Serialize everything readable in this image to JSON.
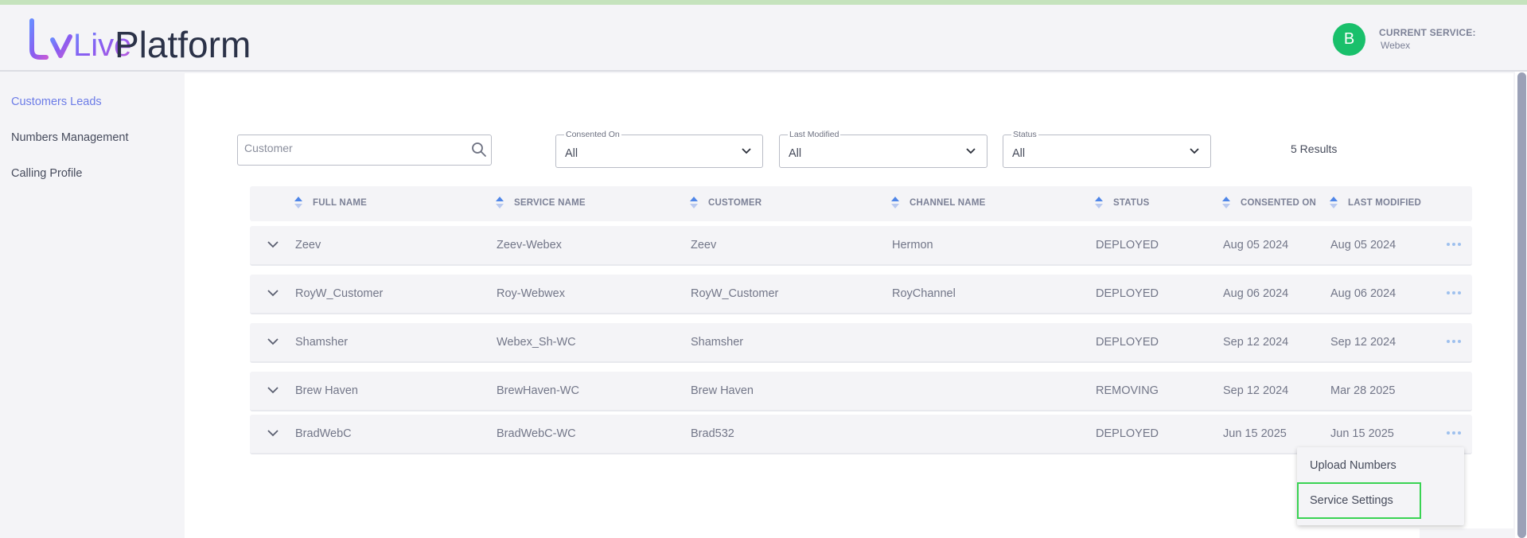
{
  "colors": {
    "accent": "#6c7ce7",
    "avatar": "#19c06b",
    "highlight": "#39d353",
    "sort_icon": "#4f86e8"
  },
  "header": {
    "logo_text_1": "Live",
    "logo_text_2": "Platform",
    "avatar_initial": "B",
    "current_service_label": "CURRENT SERVICE:",
    "current_service_value": "Webex"
  },
  "sidebar": {
    "items": [
      {
        "label": "Customers Leads",
        "active": true
      },
      {
        "label": "Numbers Management",
        "active": false
      },
      {
        "label": "Calling Profile",
        "active": false
      }
    ]
  },
  "filters": {
    "search_placeholder": "Customer",
    "search_icon": "search-icon",
    "consented_on": {
      "label": "Consented On",
      "value": "All"
    },
    "last_modified": {
      "label": "Last Modified",
      "value": "All"
    },
    "status": {
      "label": "Status",
      "value": "All"
    },
    "results": "5 Results"
  },
  "table": {
    "columns": [
      "FULL NAME",
      "SERVICE NAME",
      "CUSTOMER",
      "CHANNEL NAME",
      "STATUS",
      "CONSENTED ON",
      "LAST MODIFIED"
    ],
    "rows": [
      {
        "full_name": "Zeev",
        "service_name": "Zeev-Webex",
        "customer": "Zeev",
        "channel_name": "Hermon",
        "status": "DEPLOYED",
        "consented_on": "Aug 05 2024",
        "last_modified": "Aug 05 2024"
      },
      {
        "full_name": "RoyW_Customer",
        "service_name": "Roy-Webwex",
        "customer": "RoyW_Customer",
        "channel_name": "RoyChannel",
        "status": "DEPLOYED",
        "consented_on": "Aug 06 2024",
        "last_modified": "Aug 06 2024"
      },
      {
        "full_name": "Shamsher",
        "service_name": "Webex_Sh-WC",
        "customer": "Shamsher",
        "channel_name": "",
        "status": "DEPLOYED",
        "consented_on": "Sep 12 2024",
        "last_modified": "Sep 12 2024"
      },
      {
        "full_name": "Brew Haven",
        "service_name": "BrewHaven-WC",
        "customer": "Brew Haven",
        "channel_name": "",
        "status": "REMOVING",
        "consented_on": "Sep 12 2024",
        "last_modified": "Mar 28 2025"
      },
      {
        "full_name": "BradWebC",
        "service_name": "BradWebC-WC",
        "customer": "Brad532",
        "channel_name": "",
        "status": "DEPLOYED",
        "consented_on": "Jun 15 2025",
        "last_modified": "Jun 15 2025"
      }
    ]
  },
  "context_menu": {
    "items": [
      "Upload Numbers",
      "Service Settings"
    ]
  }
}
